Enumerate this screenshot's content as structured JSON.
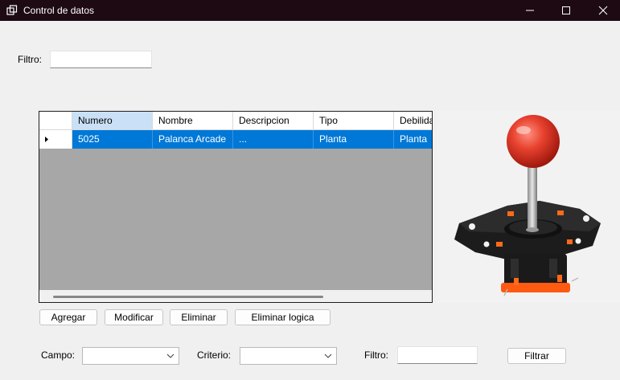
{
  "window": {
    "title": "Control de datos"
  },
  "filter_top": {
    "label": "Filtro:",
    "value": ""
  },
  "grid": {
    "columns": [
      "Numero",
      "Nombre",
      "Descripcion",
      "Tipo",
      "Debilidad"
    ],
    "rows": [
      {
        "numero": "5025",
        "nombre": "Palanca Arcade",
        "descripcion": "...",
        "tipo": "Planta",
        "debilidad": "Planta"
      }
    ],
    "selected_color": "#0078d7"
  },
  "picture": {
    "subject": "joystick-image"
  },
  "buttons": {
    "agregar": "Agregar",
    "modificar": "Modificar",
    "eliminar": "Eliminar",
    "eliminar_logica": "Eliminar logica",
    "filtrar": "Filtrar"
  },
  "advanced_filter": {
    "campo_label": "Campo:",
    "campo_value": "",
    "criterio_label": "Criterio:",
    "criterio_value": "",
    "filtro_label": "Filtro:",
    "filtro_value": ""
  }
}
